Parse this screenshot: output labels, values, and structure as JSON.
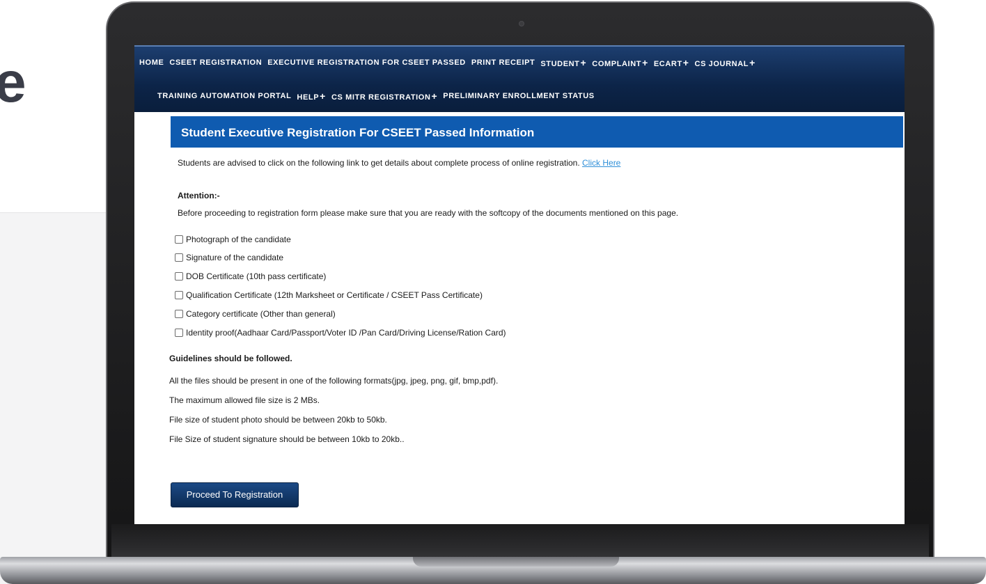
{
  "background": {
    "heading_glyph": "e"
  },
  "nav": {
    "row1": [
      {
        "label": "HOME",
        "plus": ""
      },
      {
        "label": "CSEET REGISTRATION",
        "plus": ""
      },
      {
        "label": "EXECUTIVE REGISTRATION FOR CSEET PASSED",
        "plus": ""
      },
      {
        "label": "PRINT RECEIPT",
        "plus": ""
      },
      {
        "label": "STUDENT",
        "plus": "+"
      },
      {
        "label": "COMPLAINT",
        "plus": "+"
      },
      {
        "label": "ECART",
        "plus": "+"
      },
      {
        "label": "CS JOURNAL",
        "plus": "+"
      }
    ],
    "row2": [
      {
        "label": "TRAINING AUTOMATION PORTAL",
        "plus": ""
      },
      {
        "label": "HELP",
        "plus": "+"
      },
      {
        "label": "CS MITR REGISTRATION",
        "plus": "+"
      },
      {
        "label": "PRELIMINARY ENROLLMENT STATUS",
        "plus": ""
      }
    ]
  },
  "page": {
    "title": "Student Executive Registration For CSEET Passed Information",
    "intro_text": "Students are advised to click on the following link to get details about complete process of online registration.",
    "intro_link": "Click Here",
    "attention_label": "Attention:-",
    "attention_text": "Before proceeding to registration form please make sure that you are ready with the softcopy of the documents mentioned on this page.",
    "documents": [
      "Photograph of the candidate",
      "Signature of the candidate",
      "DOB Certificate (10th pass certificate)",
      "Qualification Certificate (12th Marksheet or Certificate / CSEET Pass Certificate)",
      "Category certificate (Other than general)",
      "Identity proof(Aadhaar Card/Passport/Voter ID /Pan Card/Driving License/Ration Card)"
    ],
    "guidelines_title": "Guidelines should be followed.",
    "guidelines": [
      "All the files should be present in one of the following formats(jpg, jpeg, png, gif, bmp,pdf).",
      "The maximum allowed file size is 2 MBs.",
      "File size of student photo should be between 20kb to 50kb.",
      "File Size of student signature should be between 10kb to 20kb.."
    ],
    "proceed_button": "Proceed To Registration"
  },
  "colors": {
    "nav_bg": "#0c2448",
    "title_bar": "#0f5bb0",
    "link": "#2f8fd8",
    "button": "#0b2a52"
  }
}
